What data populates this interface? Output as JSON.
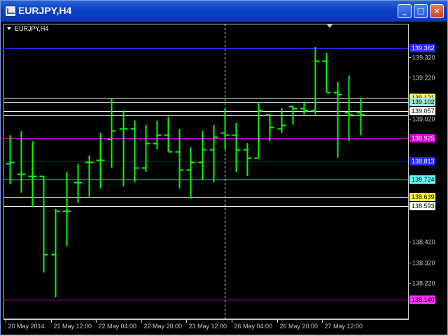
{
  "window": {
    "title": "EURJPY,H4",
    "buttons": {
      "minimize": "_",
      "maximize": "□",
      "close": "×"
    }
  },
  "chart_data": {
    "type": "ohlc",
    "symbol_label": "EURJPY,H4",
    "ylim": [
      138.05,
      139.475
    ],
    "y_ticks": [
      139.32,
      139.22,
      139.02,
      138.42,
      138.32,
      138.22
    ],
    "x_tick_labels": [
      {
        "label": "20 May 2014",
        "bar": 0
      },
      {
        "label": "21 May 12:00",
        "bar": 4
      },
      {
        "label": "22 May 04:00",
        "bar": 8
      },
      {
        "label": "22 May 20:00",
        "bar": 12
      },
      {
        "label": "23 May 12:00",
        "bar": 16
      },
      {
        "label": "26 May 04:00",
        "bar": 20
      },
      {
        "label": "26 May 20:00",
        "bar": 24
      },
      {
        "label": "27 May 12:00",
        "bar": 28
      }
    ],
    "crosshair_bar": 19,
    "bar_color": "#00ff00",
    "bars": [
      {
        "o": 138.8,
        "h": 138.94,
        "l": 138.7,
        "c": 138.81
      },
      {
        "o": 138.75,
        "h": 138.96,
        "l": 138.66,
        "c": 138.75
      },
      {
        "o": 138.74,
        "h": 138.91,
        "l": 138.59,
        "c": 138.74
      },
      {
        "o": 138.74,
        "h": 138.71,
        "l": 138.27,
        "c": 138.36
      },
      {
        "o": 138.36,
        "h": 138.58,
        "l": 138.15,
        "c": 138.57
      },
      {
        "o": 138.57,
        "h": 138.76,
        "l": 138.4,
        "c": 138.57
      },
      {
        "o": 138.71,
        "h": 138.8,
        "l": 138.61,
        "c": 138.71
      },
      {
        "o": 138.81,
        "h": 138.84,
        "l": 138.64,
        "c": 138.81
      },
      {
        "o": 138.82,
        "h": 138.95,
        "l": 138.68,
        "c": 138.82
      },
      {
        "o": 138.92,
        "h": 139.12,
        "l": 138.78,
        "c": 138.96
      },
      {
        "o": 138.97,
        "h": 139.06,
        "l": 138.69,
        "c": 138.97
      },
      {
        "o": 138.97,
        "h": 139.01,
        "l": 138.71,
        "c": 138.78
      },
      {
        "o": 138.78,
        "h": 138.99,
        "l": 138.76,
        "c": 138.9
      },
      {
        "o": 138.9,
        "h": 139.01,
        "l": 138.87,
        "c": 138.94
      },
      {
        "o": 138.94,
        "h": 139.03,
        "l": 138.86,
        "c": 138.86
      },
      {
        "o": 138.86,
        "h": 138.97,
        "l": 138.68,
        "c": 138.77
      },
      {
        "o": 138.77,
        "h": 138.88,
        "l": 138.63,
        "c": 138.81
      },
      {
        "o": 138.81,
        "h": 138.96,
        "l": 138.72,
        "c": 138.87
      },
      {
        "o": 138.87,
        "h": 138.99,
        "l": 138.71,
        "c": 138.93
      },
      {
        "o": 138.95,
        "h": 139.07,
        "l": 138.87,
        "c": 138.94
      },
      {
        "o": 138.94,
        "h": 139.0,
        "l": 138.76,
        "c": 138.87
      },
      {
        "o": 138.87,
        "h": 138.9,
        "l": 138.74,
        "c": 138.83
      },
      {
        "o": 138.83,
        "h": 139.1,
        "l": 138.84,
        "c": 139.06
      },
      {
        "o": 139.04,
        "h": 139.04,
        "l": 138.91,
        "c": 138.98
      },
      {
        "o": 138.97,
        "h": 139.07,
        "l": 138.95,
        "c": 138.99
      },
      {
        "o": 139.08,
        "h": 139.07,
        "l": 138.99,
        "c": 139.07
      },
      {
        "o": 139.07,
        "h": 139.1,
        "l": 139.04,
        "c": 139.06
      },
      {
        "o": 139.06,
        "h": 139.37,
        "l": 139.04,
        "c": 139.3
      },
      {
        "o": 139.3,
        "h": 139.34,
        "l": 139.15,
        "c": 139.15
      },
      {
        "o": 139.15,
        "h": 139.2,
        "l": 138.83,
        "c": 139.14
      },
      {
        "o": 139.05,
        "h": 139.23,
        "l": 138.91,
        "c": 139.04
      },
      {
        "o": 139.05,
        "h": 139.12,
        "l": 138.94,
        "c": 139.04
      }
    ],
    "hlines": [
      {
        "price": 139.363,
        "color": "#2626ff",
        "label": "139.362",
        "label_bg": "#2626ff",
        "label_fg": "#ffffff"
      },
      {
        "price": 139.121,
        "color": "#ffffc8",
        "label": "139.121",
        "label_bg": "#ffff66",
        "label_fg": "#000000"
      },
      {
        "price": 139.102,
        "color": "#9ff0e8",
        "label": "139.102",
        "label_bg": "#9ff0e8",
        "label_fg": "#000000"
      },
      {
        "price": 139.057,
        "color": "#ffffff",
        "label": "139.057",
        "label_bg": "#ffffff",
        "label_fg": "#000000"
      },
      {
        "price": 139.035,
        "color": "#c8c8c8",
        "label": "",
        "label_bg": "",
        "label_fg": ""
      },
      {
        "price": 138.925,
        "color": "#d400d4",
        "label": "138.925",
        "label_bg": "#d400d4",
        "label_fg": "#ffffff"
      },
      {
        "price": 138.813,
        "color": "#0000cc",
        "label": "138.813",
        "label_bg": "#2626ff",
        "label_fg": "#ffffff"
      },
      {
        "price": 138.724,
        "color": "#33dddd",
        "label": "138.724",
        "label_bg": "#66ffff",
        "label_fg": "#000000"
      },
      {
        "price": 138.639,
        "color": "#e8e800",
        "label": "138.639",
        "label_bg": "#ffff33",
        "label_fg": "#000000"
      },
      {
        "price": 138.593,
        "color": "#ffffff",
        "label": "138.593",
        "label_bg": "#ffffff",
        "label_fg": "#000000"
      },
      {
        "price": 138.14,
        "color": "#d400d4",
        "label": "138.140",
        "label_bg": "#ff33ff",
        "label_fg": "#000000"
      }
    ]
  }
}
